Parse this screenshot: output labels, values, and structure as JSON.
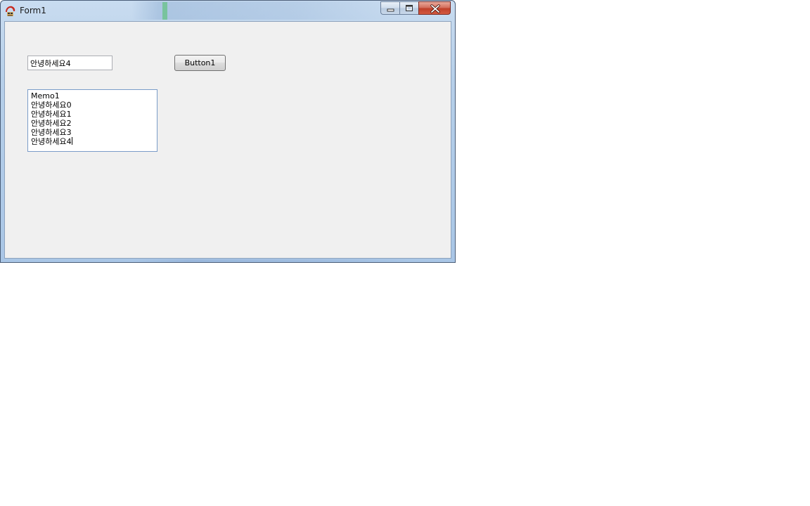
{
  "window": {
    "title": "Form1"
  },
  "titlebar": {
    "icons": {
      "app": "delphi-helmet-icon",
      "minimize": "minimize-icon",
      "maximize": "maximize-icon",
      "close": "close-icon"
    }
  },
  "form": {
    "edit1": {
      "value": "안녕하세요4"
    },
    "button1": {
      "label": "Button1"
    },
    "memo1": {
      "lines": [
        "Memo1",
        "안녕하세요0",
        "안녕하세요1",
        "안녕하세요2",
        "안녕하세요3",
        "안녕하세요4"
      ]
    }
  },
  "colors": {
    "client_background": "#f0f0f0",
    "titlebar_background": "#b6cfe9",
    "close_button": "#c0402a"
  }
}
